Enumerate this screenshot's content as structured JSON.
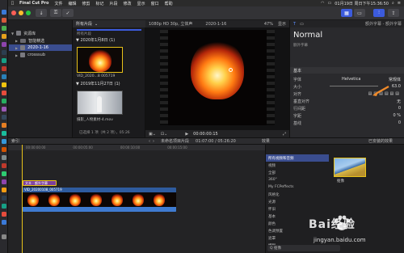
{
  "menubar": {
    "app": "Final Cut Pro",
    "items": [
      "文件",
      "编辑",
      "修剪",
      "标记",
      "片段",
      "修改",
      "显示",
      "窗口",
      "帮助"
    ],
    "datetime": "01月19日 周日下午15:36:50"
  },
  "libraries": {
    "root": "资源库",
    "items": [
      {
        "label": "智能精选",
        "selected": false
      },
      {
        "label": "2020-1-16",
        "selected": true
      },
      {
        "label": "crosssub",
        "selected": false
      }
    ]
  },
  "browser": {
    "filter": "所有片段",
    "sections": [
      {
        "date": "2020年1月8日",
        "count": "(1)",
        "clip": "VID_2020...8 005719"
      },
      {
        "date": "2019年11月27日",
        "count": "(1)",
        "clip": "摄影_人物素材-4.mov"
      }
    ],
    "status": "已选择 1 项（共 2 项），05:26",
    "top_label": "所有片段"
  },
  "viewer": {
    "format": "1080p HD 30p, 立体声",
    "project": "2020-1-16",
    "zoom": "47%",
    "view": "显示",
    "timecode": "00:00:00:15"
  },
  "inspector": {
    "tab": "额外字幕 - 额外字幕",
    "heading": "Normal",
    "subheading": "额外字幕",
    "section": "基本",
    "rows": [
      {
        "label": "字体",
        "value": "Helvetica",
        "extra": "常规体"
      },
      {
        "label": "大小",
        "value": "63.0"
      },
      {
        "label": "对齐",
        "value": ""
      },
      {
        "label": "垂直对齐",
        "value": "无"
      },
      {
        "label": "行间距",
        "value": "0"
      },
      {
        "label": "字距",
        "value": "0 %"
      },
      {
        "label": "基线",
        "value": "0"
      }
    ]
  },
  "timeline_bar": {
    "index": "索引",
    "title": "未命名项目片段",
    "timecode": "01:07:00 / 05:26:20",
    "effects": "效果",
    "installed": "已安装的效果"
  },
  "timeline": {
    "ruler": [
      "00:00:00:00",
      "00:00:05:00",
      "00:00:10:00",
      "00:00:15:00"
    ],
    "title_clip": "文本 - 额外字幕",
    "video_clip": "VID_20200108_005719"
  },
  "effects": {
    "categories": [
      {
        "label": "所有视频和音频",
        "selected": true
      },
      {
        "label": "视频",
        "selected": false
      },
      {
        "label": "全部",
        "selected": false
      },
      {
        "label": "360°",
        "selected": false
      },
      {
        "label": "My FCPeffects",
        "selected": false
      },
      {
        "label": "风格化",
        "selected": false
      },
      {
        "label": "光源",
        "selected": false
      },
      {
        "label": "怀旧",
        "selected": false
      },
      {
        "label": "基本",
        "selected": false
      },
      {
        "label": "颜色",
        "selected": false
      },
      {
        "label": "色调预置",
        "selected": false
      },
      {
        "label": "遮罩",
        "selected": false
      },
      {
        "label": "模糊",
        "selected": false
      }
    ],
    "item": "抠像",
    "search_placeholder": "Q 抠像"
  },
  "watermark": {
    "brand": "Bai经验",
    "url": "jingyan.baidu.com"
  },
  "colors": {
    "accent": "#3a4d8f",
    "selection": "#e8c21a",
    "title_clip": "#7b3f9e",
    "video_clip": "#2e5b9e"
  }
}
